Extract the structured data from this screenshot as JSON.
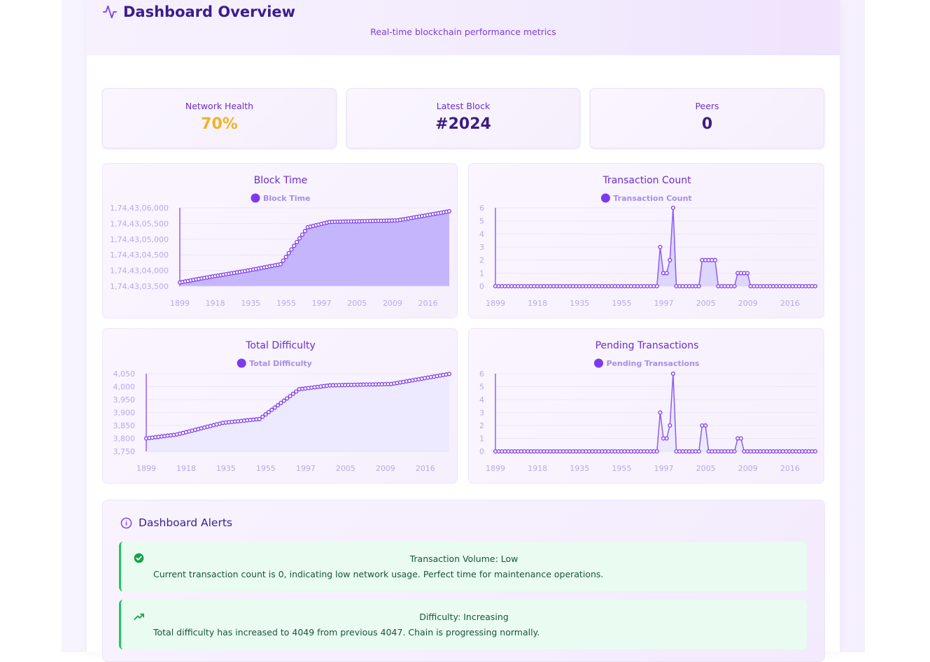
{
  "header": {
    "title": "Dashboard Overview",
    "subtitle": "Real-time blockchain performance metrics",
    "icon": "activity-icon"
  },
  "stats": [
    {
      "label": "Network Health",
      "value": "70%",
      "color": "#f0b323"
    },
    {
      "label": "Latest Block",
      "value": "#2024",
      "color": "#3d1d80"
    },
    {
      "label": "Peers",
      "value": "0",
      "color": "#3d1d80"
    }
  ],
  "colors": {
    "accent": "#7c3aed",
    "fill_strong": "#c4b5fd",
    "fill_light": "#ede9fe",
    "success": "#22c55e",
    "warning": "#f0b323"
  },
  "chart_data": [
    {
      "type": "area",
      "title": "Block Time",
      "series": [
        {
          "name": "Block Time"
        }
      ],
      "yticks": [
        "1,74,43,03,500",
        "1,74,43,04,000",
        "1,74,43,04,500",
        "1,74,43,05,000",
        "1,74,43,05,500",
        "1,74,43,06,000"
      ],
      "xticks": [
        "1899",
        "1918",
        "1935",
        "1955",
        "1997",
        "2005",
        "2009",
        "2016"
      ],
      "ylim": [
        1744303500,
        1744306000
      ],
      "n_points": 100,
      "profile": [
        [
          0,
          1744303620
        ],
        [
          10,
          1744303780
        ],
        [
          25,
          1744304000
        ],
        [
          37,
          1744304200
        ],
        [
          47,
          1744305380
        ],
        [
          55,
          1744305550
        ],
        [
          80,
          1744305600
        ],
        [
          99,
          1744305890
        ]
      ]
    },
    {
      "type": "area",
      "title": "Transaction Count",
      "series": [
        {
          "name": "Transaction Count"
        }
      ],
      "yticks": [
        "0",
        "1",
        "2",
        "3",
        "4",
        "5",
        "6"
      ],
      "xticks": [
        "1899",
        "1918",
        "1935",
        "1955",
        "1997",
        "2005",
        "2009",
        "2016"
      ],
      "ylim": [
        0,
        6
      ],
      "n_points": 100,
      "nonzero": [
        [
          51,
          3
        ],
        [
          52,
          1
        ],
        [
          53,
          1
        ],
        [
          54,
          2
        ],
        [
          55,
          6
        ],
        [
          64,
          2
        ],
        [
          65,
          2
        ],
        [
          66,
          2
        ],
        [
          67,
          2
        ],
        [
          68,
          2
        ],
        [
          75,
          1
        ],
        [
          76,
          1
        ],
        [
          77,
          1
        ],
        [
          78,
          1
        ]
      ]
    },
    {
      "type": "area",
      "title": "Total Difficulty",
      "series": [
        {
          "name": "Total Difficulty"
        }
      ],
      "yticks": [
        "3,750",
        "3,800",
        "3,850",
        "3,900",
        "3,950",
        "4,000",
        "4,050"
      ],
      "xticks": [
        "1899",
        "1918",
        "1935",
        "1955",
        "1997",
        "2005",
        "2009",
        "2016"
      ],
      "ylim": [
        3750,
        4050
      ],
      "n_points": 100,
      "profile": [
        [
          0,
          3800
        ],
        [
          10,
          3815
        ],
        [
          25,
          3860
        ],
        [
          37,
          3875
        ],
        [
          50,
          3990
        ],
        [
          60,
          4005
        ],
        [
          80,
          4010
        ],
        [
          99,
          4049
        ]
      ]
    },
    {
      "type": "area",
      "title": "Pending Transactions",
      "series": [
        {
          "name": "Pending Transactions"
        }
      ],
      "yticks": [
        "0",
        "1",
        "2",
        "3",
        "4",
        "5",
        "6"
      ],
      "xticks": [
        "1899",
        "1918",
        "1935",
        "1955",
        "1997",
        "2005",
        "2009",
        "2016"
      ],
      "ylim": [
        0,
        6
      ],
      "n_points": 100,
      "nonzero": [
        [
          51,
          3
        ],
        [
          52,
          1
        ],
        [
          53,
          1
        ],
        [
          54,
          2
        ],
        [
          55,
          6
        ],
        [
          64,
          2
        ],
        [
          65,
          2
        ],
        [
          75,
          1
        ],
        [
          76,
          1
        ]
      ]
    }
  ],
  "alerts": {
    "title": "Dashboard Alerts",
    "items": [
      {
        "icon": "check-circle-icon",
        "title": "Transaction Volume: Low",
        "message": "Current transaction count is 0, indicating low network usage. Perfect time for maintenance operations."
      },
      {
        "icon": "trending-up-icon",
        "title": "Difficulty: Increasing",
        "message": "Total difficulty has increased to 4049 from previous 4047. Chain is progressing normally."
      }
    ]
  }
}
